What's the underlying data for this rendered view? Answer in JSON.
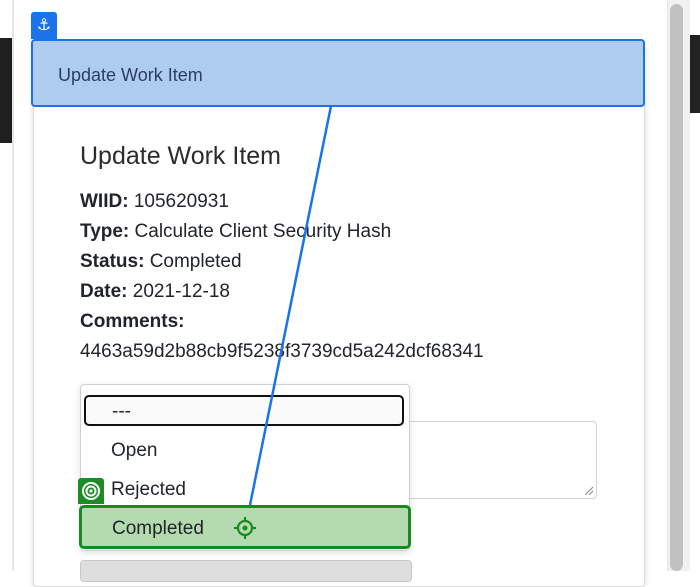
{
  "window": {
    "title": "Update Work Item"
  },
  "page": {
    "heading": "Update Work Item",
    "fields": {
      "wiid_label": "WIID:",
      "wiid_value": "105620931",
      "type_label": "Type:",
      "type_value": "Calculate Client Security Hash",
      "status_label": "Status:",
      "status_value": "Completed",
      "date_label": "Date:",
      "date_value": "2021-12-18",
      "comments_label": "Comments:",
      "comments_value": "4463a59d2b88cb9f5238f3739cd5a242dcf68341"
    }
  },
  "status_select": {
    "options": [
      "---",
      "Open",
      "Rejected",
      "Completed"
    ],
    "highlighted": "Completed"
  },
  "icons": {
    "anchor": "anchor-icon",
    "target_badge": "target-icon",
    "crosshair": "crosshair-icon"
  },
  "colors": {
    "title_bar_bg": "#aecbf0",
    "title_bar_border": "#1a73e8",
    "highlight_bg": "#b4dbb0",
    "highlight_border": "#198a20"
  }
}
